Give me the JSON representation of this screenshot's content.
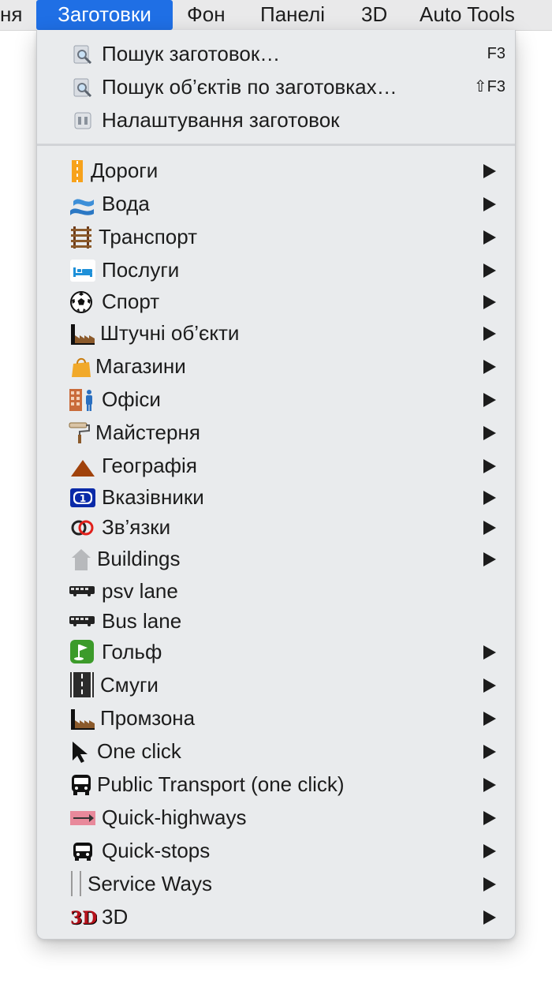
{
  "menubar": {
    "items": [
      {
        "label": "ня"
      },
      {
        "label": "Заготовки"
      },
      {
        "label": "Фон"
      },
      {
        "label": "Панелі"
      },
      {
        "label": "3D"
      },
      {
        "label": "Auto Tools"
      }
    ],
    "active_color": "#1f6fe5"
  },
  "menu": {
    "top_items": [
      {
        "label": "Пошук заготовок…",
        "shortcut": "F3",
        "icon": "preset-search-icon"
      },
      {
        "label": "Пошук об’єктів по заготовках…",
        "shortcut": "⇧F3",
        "icon": "object-search-icon"
      },
      {
        "label": "Налаштування заготовок",
        "icon": "preset-preferences-icon"
      }
    ],
    "items": [
      {
        "label": "Дороги",
        "icon": "roads-icon",
        "submenu": true
      },
      {
        "label": "Вода",
        "icon": "water-icon",
        "submenu": true
      },
      {
        "label": "Транспорт",
        "icon": "railway-icon",
        "submenu": true
      },
      {
        "label": "Послуги",
        "icon": "bed-icon",
        "submenu": true
      },
      {
        "label": "Спорт",
        "icon": "soccer-ball-icon",
        "submenu": true
      },
      {
        "label": "Штучні об’єкти",
        "icon": "factory-icon",
        "submenu": true
      },
      {
        "label": "Магазини",
        "icon": "shopping-bag-icon",
        "submenu": true
      },
      {
        "label": "Офіси",
        "icon": "office-icon",
        "submenu": true
      },
      {
        "label": "Майстерня",
        "icon": "paint-roller-icon",
        "submenu": true
      },
      {
        "label": "Географія",
        "icon": "mountain-icon",
        "submenu": true
      },
      {
        "label": "Вказівники",
        "icon": "route-shield-icon",
        "submenu": true
      },
      {
        "label": "Зв’язки",
        "icon": "relations-icon",
        "submenu": true
      },
      {
        "label": "Buildings",
        "icon": "house-icon",
        "submenu": true
      },
      {
        "label": "psv lane",
        "icon": "bus-side-icon",
        "submenu": false
      },
      {
        "label": "Bus lane",
        "icon": "bus-side-icon",
        "submenu": false
      },
      {
        "label": "Гольф",
        "icon": "golf-flag-icon",
        "submenu": true
      },
      {
        "label": "Смуги",
        "icon": "lanes-icon",
        "submenu": true
      },
      {
        "label": "Промзона",
        "icon": "factory-icon",
        "submenu": true
      },
      {
        "label": "One click",
        "icon": "cursor-arrow-icon",
        "submenu": true
      },
      {
        "label": "Public Transport (one click)",
        "icon": "bus-front-icon",
        "submenu": true
      },
      {
        "label": "Quick-highways",
        "icon": "highway-arrow-icon",
        "submenu": true
      },
      {
        "label": "Quick-stops",
        "icon": "bus-stop-icon",
        "submenu": true
      },
      {
        "label": "Service Ways",
        "icon": "service-way-icon",
        "submenu": true
      },
      {
        "label": "3D",
        "icon": "3d-icon",
        "submenu": true
      }
    ]
  }
}
